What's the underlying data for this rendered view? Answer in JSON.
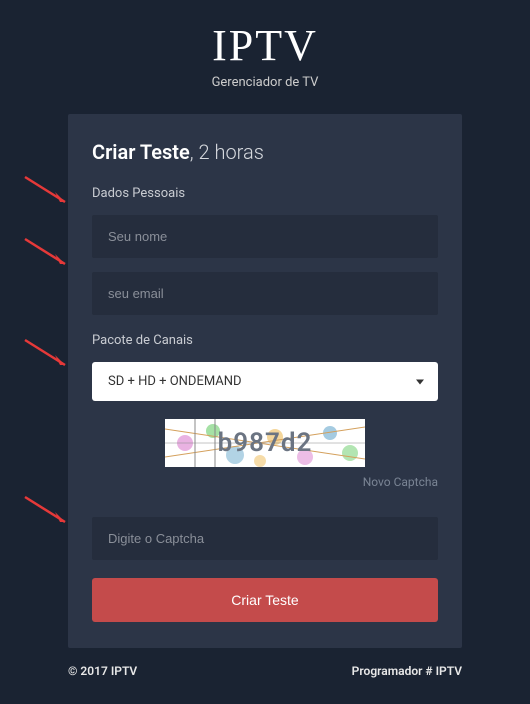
{
  "header": {
    "logo": "IPTV",
    "subtitle": "Gerenciador de TV"
  },
  "card": {
    "title_bold": "Criar Teste",
    "title_rest": ", 2 horas",
    "section_personal": "Dados Pessoais",
    "name_placeholder": "Seu nome",
    "email_placeholder": "seu email",
    "section_package": "Pacote de Canais",
    "package_selected": "SD + HD + ONDEMAND",
    "captcha_value": "b987d2",
    "captcha_refresh": "Novo Captcha",
    "captcha_placeholder": "Digite o Captcha",
    "submit_label": "Criar Teste"
  },
  "footer": {
    "copyright": "© 2017 IPTV",
    "credit": "Programador # IPTV"
  }
}
